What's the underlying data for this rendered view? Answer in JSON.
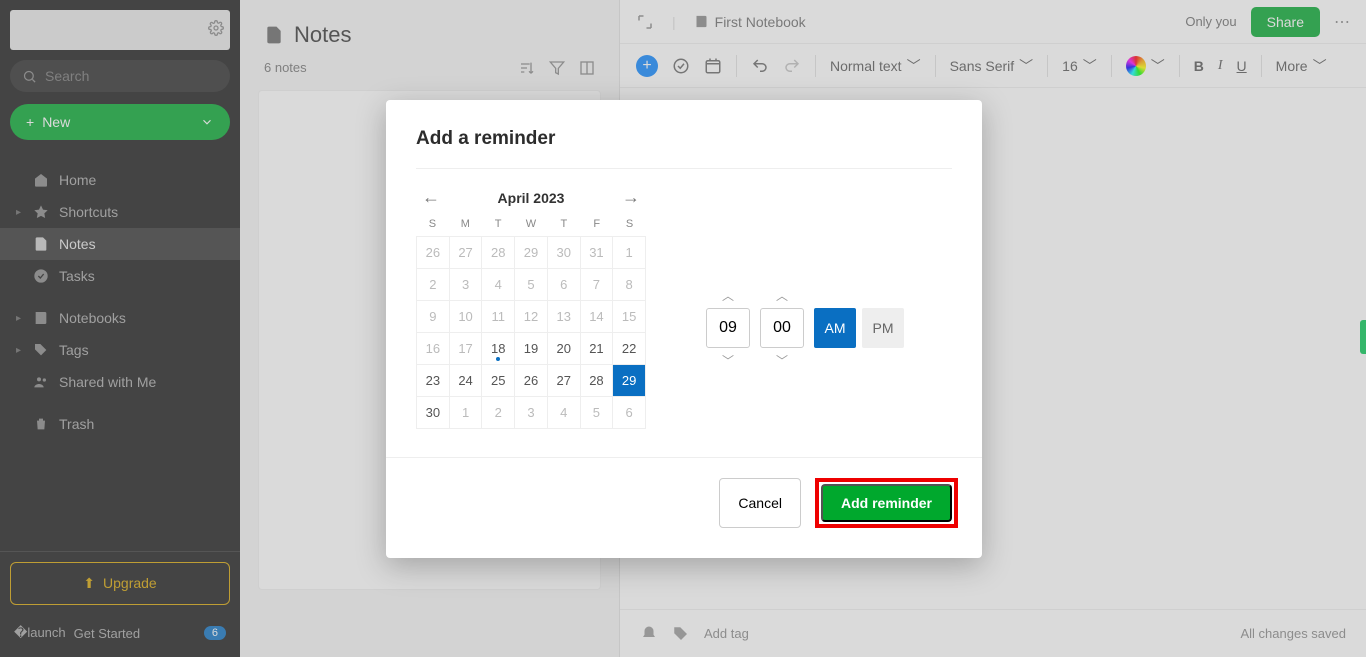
{
  "sidebar": {
    "search_placeholder": "Search",
    "new_label": "New",
    "items": [
      {
        "label": "Home"
      },
      {
        "label": "Shortcuts"
      },
      {
        "label": "Notes"
      },
      {
        "label": "Tasks"
      },
      {
        "label": "Notebooks"
      },
      {
        "label": "Tags"
      },
      {
        "label": "Shared with Me"
      },
      {
        "label": "Trash"
      }
    ],
    "upgrade": "Upgrade",
    "get_started": "Get Started",
    "badge": "6"
  },
  "notes_column": {
    "title": "Notes",
    "count": "6 notes"
  },
  "editor": {
    "notebook": "First Notebook",
    "only_you": "Only you",
    "share": "Share",
    "format": "Normal text",
    "font": "Sans Serif",
    "size": "16",
    "more": "More",
    "add_tag": "Add tag",
    "saved": "All changes saved"
  },
  "modal": {
    "title": "Add a reminder",
    "month_label": "April 2023",
    "dow": [
      "S",
      "M",
      "T",
      "W",
      "T",
      "F",
      "S"
    ],
    "weeks": [
      [
        {
          "n": "26",
          "o": true
        },
        {
          "n": "27",
          "o": true
        },
        {
          "n": "28",
          "o": true
        },
        {
          "n": "29",
          "o": true
        },
        {
          "n": "30",
          "o": true
        },
        {
          "n": "31",
          "o": true
        },
        {
          "n": "1",
          "o": true
        }
      ],
      [
        {
          "n": "2",
          "o": true
        },
        {
          "n": "3",
          "o": true
        },
        {
          "n": "4",
          "o": true
        },
        {
          "n": "5",
          "o": true
        },
        {
          "n": "6",
          "o": true
        },
        {
          "n": "7",
          "o": true
        },
        {
          "n": "8",
          "o": true
        }
      ],
      [
        {
          "n": "9",
          "o": true
        },
        {
          "n": "10",
          "o": true
        },
        {
          "n": "11",
          "o": true
        },
        {
          "n": "12",
          "o": true
        },
        {
          "n": "13",
          "o": true
        },
        {
          "n": "14",
          "o": true
        },
        {
          "n": "15",
          "o": true
        }
      ],
      [
        {
          "n": "16",
          "o": true
        },
        {
          "n": "17",
          "o": true
        },
        {
          "n": "18",
          "today": true
        },
        {
          "n": "19"
        },
        {
          "n": "20"
        },
        {
          "n": "21"
        },
        {
          "n": "22"
        }
      ],
      [
        {
          "n": "23"
        },
        {
          "n": "24"
        },
        {
          "n": "25"
        },
        {
          "n": "26"
        },
        {
          "n": "27"
        },
        {
          "n": "28"
        },
        {
          "n": "29",
          "sel": true
        }
      ],
      [
        {
          "n": "30"
        },
        {
          "n": "1",
          "o": true
        },
        {
          "n": "2",
          "o": true
        },
        {
          "n": "3",
          "o": true
        },
        {
          "n": "4",
          "o": true
        },
        {
          "n": "5",
          "o": true
        },
        {
          "n": "6",
          "o": true
        }
      ]
    ],
    "hour": "09",
    "minute": "00",
    "am": "AM",
    "pm": "PM",
    "cancel": "Cancel",
    "add": "Add reminder"
  }
}
